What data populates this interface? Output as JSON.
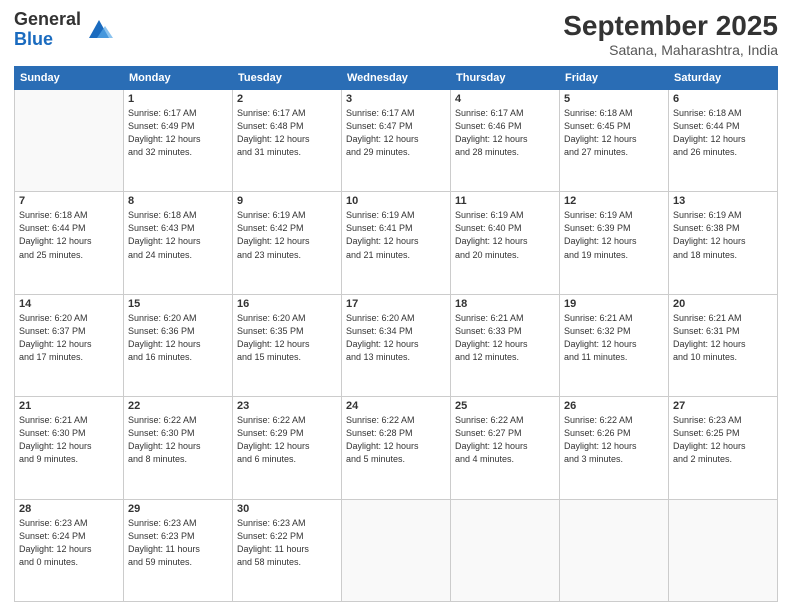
{
  "header": {
    "logo_general": "General",
    "logo_blue": "Blue",
    "month_title": "September 2025",
    "location": "Satana, Maharashtra, India"
  },
  "weekdays": [
    "Sunday",
    "Monday",
    "Tuesday",
    "Wednesday",
    "Thursday",
    "Friday",
    "Saturday"
  ],
  "weeks": [
    [
      {
        "day": "",
        "info": ""
      },
      {
        "day": "1",
        "info": "Sunrise: 6:17 AM\nSunset: 6:49 PM\nDaylight: 12 hours\nand 32 minutes."
      },
      {
        "day": "2",
        "info": "Sunrise: 6:17 AM\nSunset: 6:48 PM\nDaylight: 12 hours\nand 31 minutes."
      },
      {
        "day": "3",
        "info": "Sunrise: 6:17 AM\nSunset: 6:47 PM\nDaylight: 12 hours\nand 29 minutes."
      },
      {
        "day": "4",
        "info": "Sunrise: 6:17 AM\nSunset: 6:46 PM\nDaylight: 12 hours\nand 28 minutes."
      },
      {
        "day": "5",
        "info": "Sunrise: 6:18 AM\nSunset: 6:45 PM\nDaylight: 12 hours\nand 27 minutes."
      },
      {
        "day": "6",
        "info": "Sunrise: 6:18 AM\nSunset: 6:44 PM\nDaylight: 12 hours\nand 26 minutes."
      }
    ],
    [
      {
        "day": "7",
        "info": "Sunrise: 6:18 AM\nSunset: 6:44 PM\nDaylight: 12 hours\nand 25 minutes."
      },
      {
        "day": "8",
        "info": "Sunrise: 6:18 AM\nSunset: 6:43 PM\nDaylight: 12 hours\nand 24 minutes."
      },
      {
        "day": "9",
        "info": "Sunrise: 6:19 AM\nSunset: 6:42 PM\nDaylight: 12 hours\nand 23 minutes."
      },
      {
        "day": "10",
        "info": "Sunrise: 6:19 AM\nSunset: 6:41 PM\nDaylight: 12 hours\nand 21 minutes."
      },
      {
        "day": "11",
        "info": "Sunrise: 6:19 AM\nSunset: 6:40 PM\nDaylight: 12 hours\nand 20 minutes."
      },
      {
        "day": "12",
        "info": "Sunrise: 6:19 AM\nSunset: 6:39 PM\nDaylight: 12 hours\nand 19 minutes."
      },
      {
        "day": "13",
        "info": "Sunrise: 6:19 AM\nSunset: 6:38 PM\nDaylight: 12 hours\nand 18 minutes."
      }
    ],
    [
      {
        "day": "14",
        "info": "Sunrise: 6:20 AM\nSunset: 6:37 PM\nDaylight: 12 hours\nand 17 minutes."
      },
      {
        "day": "15",
        "info": "Sunrise: 6:20 AM\nSunset: 6:36 PM\nDaylight: 12 hours\nand 16 minutes."
      },
      {
        "day": "16",
        "info": "Sunrise: 6:20 AM\nSunset: 6:35 PM\nDaylight: 12 hours\nand 15 minutes."
      },
      {
        "day": "17",
        "info": "Sunrise: 6:20 AM\nSunset: 6:34 PM\nDaylight: 12 hours\nand 13 minutes."
      },
      {
        "day": "18",
        "info": "Sunrise: 6:21 AM\nSunset: 6:33 PM\nDaylight: 12 hours\nand 12 minutes."
      },
      {
        "day": "19",
        "info": "Sunrise: 6:21 AM\nSunset: 6:32 PM\nDaylight: 12 hours\nand 11 minutes."
      },
      {
        "day": "20",
        "info": "Sunrise: 6:21 AM\nSunset: 6:31 PM\nDaylight: 12 hours\nand 10 minutes."
      }
    ],
    [
      {
        "day": "21",
        "info": "Sunrise: 6:21 AM\nSunset: 6:30 PM\nDaylight: 12 hours\nand 9 minutes."
      },
      {
        "day": "22",
        "info": "Sunrise: 6:22 AM\nSunset: 6:30 PM\nDaylight: 12 hours\nand 8 minutes."
      },
      {
        "day": "23",
        "info": "Sunrise: 6:22 AM\nSunset: 6:29 PM\nDaylight: 12 hours\nand 6 minutes."
      },
      {
        "day": "24",
        "info": "Sunrise: 6:22 AM\nSunset: 6:28 PM\nDaylight: 12 hours\nand 5 minutes."
      },
      {
        "day": "25",
        "info": "Sunrise: 6:22 AM\nSunset: 6:27 PM\nDaylight: 12 hours\nand 4 minutes."
      },
      {
        "day": "26",
        "info": "Sunrise: 6:22 AM\nSunset: 6:26 PM\nDaylight: 12 hours\nand 3 minutes."
      },
      {
        "day": "27",
        "info": "Sunrise: 6:23 AM\nSunset: 6:25 PM\nDaylight: 12 hours\nand 2 minutes."
      }
    ],
    [
      {
        "day": "28",
        "info": "Sunrise: 6:23 AM\nSunset: 6:24 PM\nDaylight: 12 hours\nand 0 minutes."
      },
      {
        "day": "29",
        "info": "Sunrise: 6:23 AM\nSunset: 6:23 PM\nDaylight: 11 hours\nand 59 minutes."
      },
      {
        "day": "30",
        "info": "Sunrise: 6:23 AM\nSunset: 6:22 PM\nDaylight: 11 hours\nand 58 minutes."
      },
      {
        "day": "",
        "info": ""
      },
      {
        "day": "",
        "info": ""
      },
      {
        "day": "",
        "info": ""
      },
      {
        "day": "",
        "info": ""
      }
    ]
  ]
}
